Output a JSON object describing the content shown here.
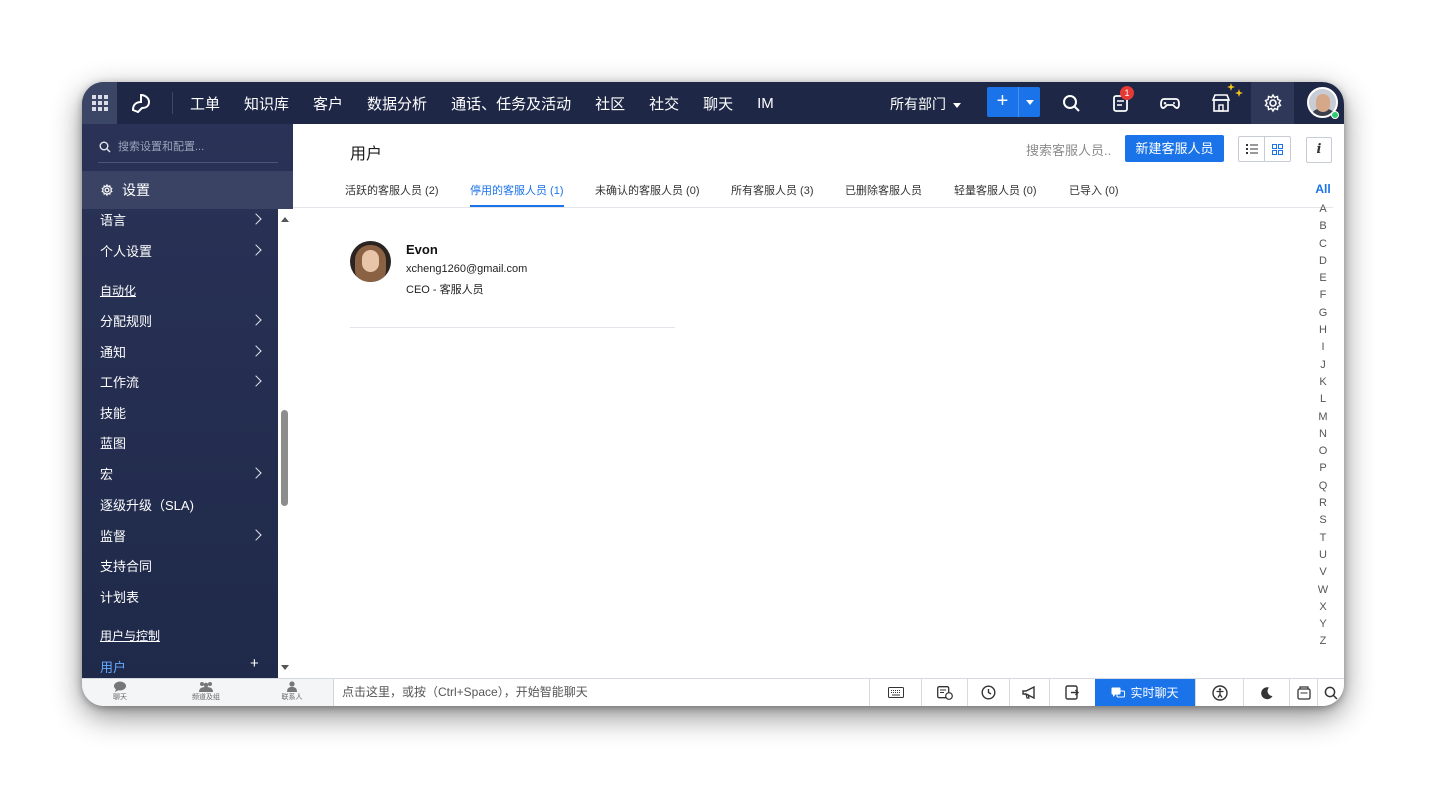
{
  "topnav": {
    "items": [
      "工单",
      "知识库",
      "客户",
      "数据分析",
      "通话、任务及活动",
      "社区",
      "社交",
      "聊天",
      "IM"
    ],
    "department": "所有部门",
    "plus_label": "+",
    "notification_count": "1"
  },
  "sidebar": {
    "search_placeholder": "搜索设置和配置...",
    "settings_label": "设置",
    "items": [
      {
        "label": "语言",
        "chevron": true
      },
      {
        "label": "个人设置",
        "chevron": true
      },
      {
        "label": "自动化",
        "heading": true
      },
      {
        "label": "分配规则",
        "chevron": true
      },
      {
        "label": "通知",
        "chevron": true
      },
      {
        "label": "工作流",
        "chevron": true
      },
      {
        "label": "技能"
      },
      {
        "label": "蓝图"
      },
      {
        "label": "宏",
        "chevron": true
      },
      {
        "label": "逐级升级（SLA)"
      },
      {
        "label": "监督",
        "chevron": true
      },
      {
        "label": "支持合同"
      },
      {
        "label": "计划表"
      },
      {
        "label": "用户与控制",
        "heading": true
      },
      {
        "label": "用户",
        "active": true,
        "plus": "+"
      }
    ]
  },
  "main": {
    "title": "用户",
    "search_placeholder": "搜索客服人员..",
    "new_button": "新建客服人员",
    "info_label": "i",
    "tabs": [
      {
        "label": "活跃的客服人员 (2)"
      },
      {
        "label": "停用的客服人员 (1)",
        "active": true
      },
      {
        "label": "未确认的客服人员 (0)"
      },
      {
        "label": "所有客服人员 (3)"
      },
      {
        "label": "已删除客服人员"
      },
      {
        "label": "轻量客服人员 (0)"
      },
      {
        "label": "已导入 (0)"
      }
    ],
    "user": {
      "name": "Evon",
      "email": "xcheng1260@gmail.com",
      "role": "CEO - 客服人员"
    },
    "alphabet_all": "All",
    "alphabet": [
      "A",
      "B",
      "C",
      "D",
      "E",
      "F",
      "G",
      "H",
      "I",
      "J",
      "K",
      "L",
      "M",
      "N",
      "O",
      "P",
      "Q",
      "R",
      "S",
      "T",
      "U",
      "V",
      "W",
      "X",
      "Y",
      "Z"
    ]
  },
  "bottombar": {
    "chat_label": "聊天",
    "channels_label": "频道及组",
    "contacts_label": "联系人",
    "chat_placeholder": "点击这里，或按（Ctrl+Space），开始智能聊天",
    "livechat_label": "实时聊天"
  },
  "colors": {
    "nav_bg": "#1e2746",
    "sidebar_bg": "#2a3357",
    "accent": "#1a73e8",
    "badge": "#e53935"
  }
}
